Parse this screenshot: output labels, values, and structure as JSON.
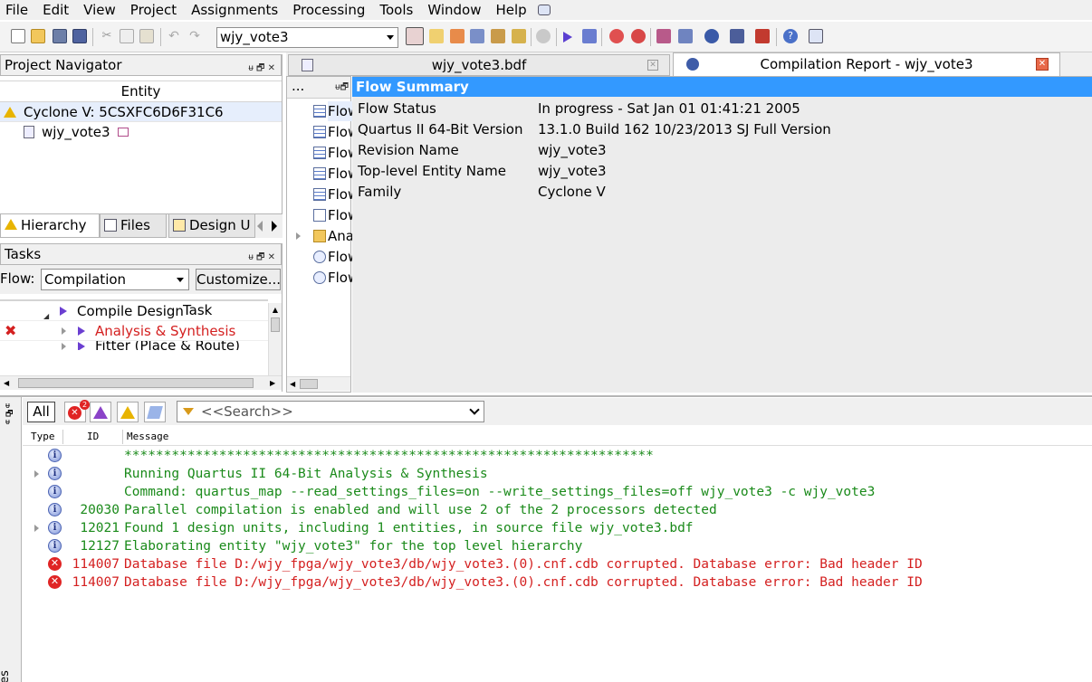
{
  "menu": [
    "File",
    "Edit",
    "View",
    "Project",
    "Assignments",
    "Processing",
    "Tools",
    "Window",
    "Help"
  ],
  "toolbar": {
    "entity_combo": "wjy_vote3"
  },
  "project_navigator": {
    "title": "Project Navigator",
    "column": "Entity",
    "device": "Cyclone V: 5CSXFC6D6F31C6",
    "top_entity": "wjy_vote3",
    "tabs": [
      "Hierarchy",
      "Files",
      "Design U"
    ]
  },
  "tasks": {
    "title": "Tasks",
    "flow_label": "Flow:",
    "flow_value": "Compilation",
    "customize_label": "Customize...",
    "column": "Task",
    "items": [
      {
        "label": "Compile Design"
      },
      {
        "label": "Analysis & Synthesis"
      },
      {
        "label": "Fitter (Place & Route)"
      }
    ]
  },
  "editor_tabs": [
    {
      "label": "wjy_vote3.bdf"
    },
    {
      "label": "Compilation Report - wjy_vote3"
    }
  ],
  "report": {
    "toc_button": "...",
    "toc_items": [
      "Flow",
      "Flow",
      "Flow",
      "Flow",
      "Flow",
      "Flow",
      "Ana",
      "Flow",
      "Flow"
    ],
    "heading": "Flow Summary",
    "rows": [
      {
        "key": "Flow Status",
        "value": "In progress - Sat Jan 01 01:41:21 2005"
      },
      {
        "key": "Quartus II 64-Bit Version",
        "value": "13.1.0 Build 162 10/23/2013 SJ Full Version"
      },
      {
        "key": "Revision Name",
        "value": "wjy_vote3"
      },
      {
        "key": "Top-level Entity Name",
        "value": "wjy_vote3"
      },
      {
        "key": "Family",
        "value": "Cyclone V"
      }
    ]
  },
  "messages": {
    "filter_all": "All",
    "error_badge": "2",
    "search_placeholder": "<<Search>>",
    "columns": {
      "type": "Type",
      "id": "ID",
      "message": "Message"
    },
    "side_label": "es",
    "rows": [
      {
        "kind": "info",
        "id": "",
        "text": "*******************************************************************",
        "color": "#1a8a1a",
        "expand": false
      },
      {
        "kind": "info",
        "id": "",
        "text": "Running Quartus II 64-Bit Analysis & Synthesis",
        "color": "#1a8a1a",
        "expand": true
      },
      {
        "kind": "info",
        "id": "",
        "text": "Command: quartus_map --read_settings_files=on --write_settings_files=off wjy_vote3 -c wjy_vote3",
        "color": "#1a8a1a",
        "expand": false
      },
      {
        "kind": "info",
        "id": "20030",
        "text": "Parallel compilation is enabled and will use 2 of the 2 processors detected",
        "color": "#1a8a1a",
        "expand": false
      },
      {
        "kind": "info",
        "id": "12021",
        "text": "Found 1 design units, including 1 entities, in source file wjy_vote3.bdf",
        "color": "#1a8a1a",
        "expand": true
      },
      {
        "kind": "info",
        "id": "12127",
        "text": "Elaborating entity \"wjy_vote3\" for the top level hierarchy",
        "color": "#1a8a1a",
        "expand": false
      },
      {
        "kind": "error",
        "id": "114007",
        "text": "Database file D:/wjy_fpga/wjy_vote3/db/wjy_vote3.(0).cnf.cdb corrupted. Database error: Bad header ID",
        "color": "#d42020",
        "expand": false
      },
      {
        "kind": "error",
        "id": "114007",
        "text": "Database file D:/wjy_fpga/wjy_vote3/db/wjy_vote3.(0).cnf.cdb corrupted. Database error: Bad header ID",
        "color": "#d42020",
        "expand": false
      }
    ]
  },
  "colors": {
    "accent": "#3399ff",
    "info": "#1a8a1a",
    "error": "#d42020"
  }
}
